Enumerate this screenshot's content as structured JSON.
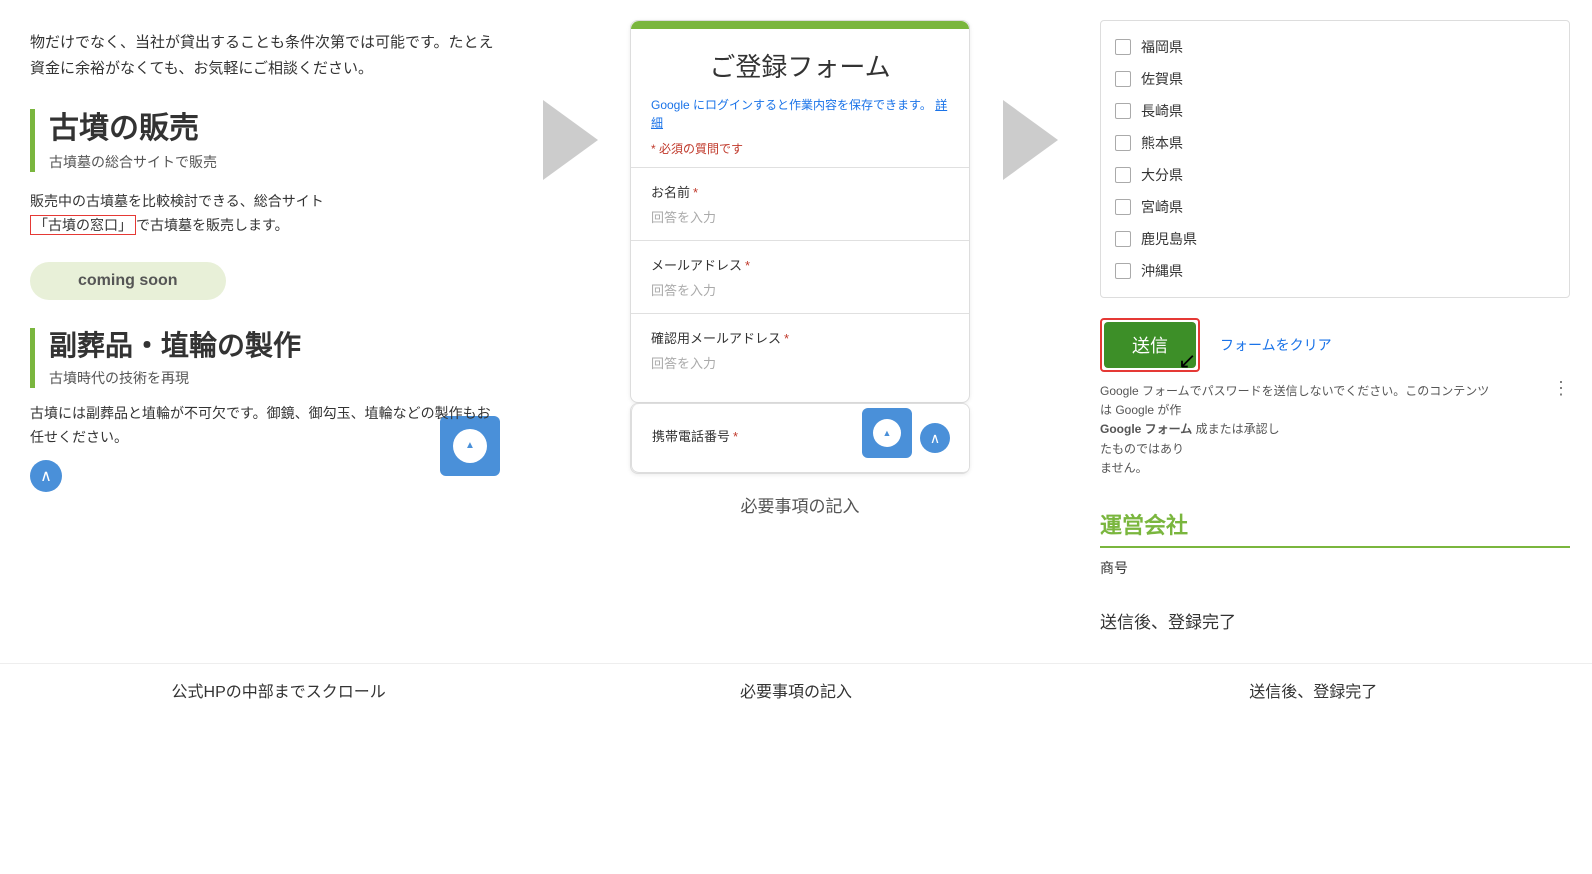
{
  "left": {
    "top_text": "物だけでなく、当社が貸出することも条件次第では可能です。たとえ資金に余裕がなくても、お気軽にご相談ください。",
    "section1": {
      "title": "古墳の販売",
      "subtitle": "古墳墓の総合サイトで販売",
      "description1": "販売中の古墳墓を比較検討できる、総合サイト",
      "link_text": "「古墳の窓口」",
      "description2": "で古墳墓を販売します。",
      "coming_soon": "coming soon"
    },
    "section2": {
      "title": "副葬品・埴輪の製作",
      "subtitle": "古墳時代の技術を再現",
      "description": "古墳には副葬品と埴輪が不可欠です。御鏡、御勾玉、埴輪などの製作もお任せください。"
    }
  },
  "arrows": {
    "label1": "→",
    "label2": "→"
  },
  "middle": {
    "form": {
      "title": "ご登録フォーム",
      "google_note": "Google にログインすると作業内容を保存できます。",
      "detail_link": "詳細",
      "required_note": "* 必須の質問です",
      "fields": [
        {
          "label": "お名前",
          "required": true,
          "placeholder": "回答を入力"
        },
        {
          "label": "メールアドレス",
          "required": true,
          "placeholder": "回答を入力"
        },
        {
          "label": "確認用メールアドレス",
          "required": true,
          "placeholder": "回答を入力"
        },
        {
          "label": "携帯電話番号",
          "required": true,
          "placeholder": ""
        }
      ]
    },
    "caption": "必要事項の記入"
  },
  "right": {
    "checkboxes": [
      "福岡県",
      "佐賀県",
      "長崎県",
      "熊本県",
      "大分県",
      "宮崎県",
      "鹿児島県",
      "沖縄県"
    ],
    "submit_label": "送信",
    "clear_label": "フォームをクリア",
    "disclaimer": "Google フォームでパスワードを送信しないでください。このコンテンツは Google が作成または承認したものではありません。",
    "google_form_label": "Google フォーム",
    "company": {
      "title": "運営会社",
      "label": "商号"
    },
    "caption": "送信後、登録完了"
  },
  "bottom_labels": {
    "left": "公式HPの中部までスクロール",
    "middle": "必要事項の記入",
    "right": "送信後、登録完了"
  }
}
